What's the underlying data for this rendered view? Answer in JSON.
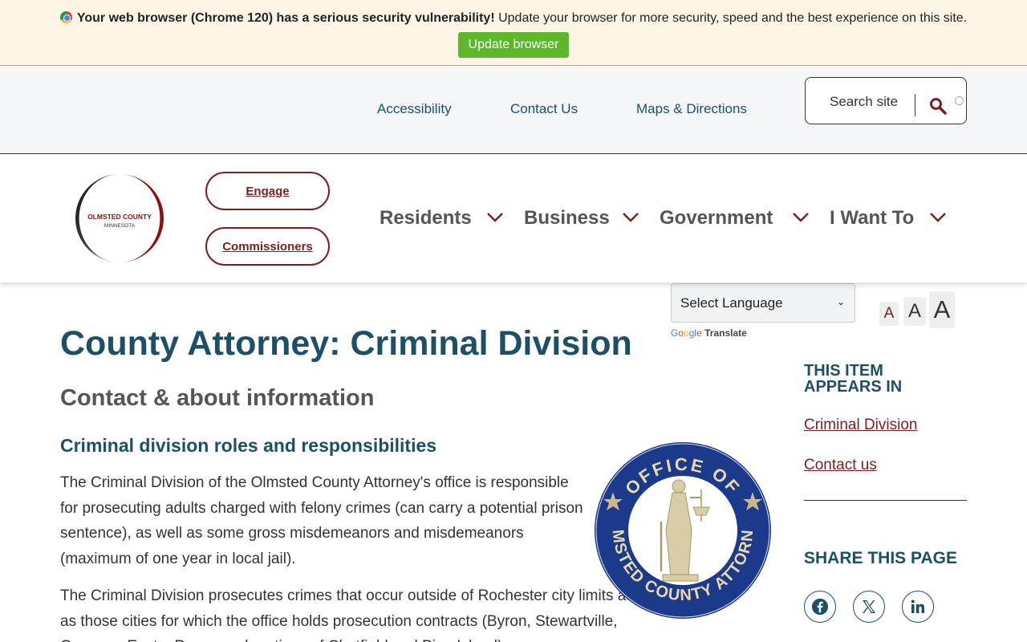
{
  "banner": {
    "bold_text": "Your web browser (Chrome 120) has a serious security vulnerability!",
    "text": " Update your browser for more security, speed and the best experience on this site.",
    "button_label": "Update browser"
  },
  "utility": {
    "links": [
      "Accessibility",
      "Contact Us",
      "Maps & Directions"
    ],
    "search_label": "Search site"
  },
  "logo": {
    "line1": "OLMSTED COUNTY",
    "line2": "MINNESOTA"
  },
  "header": {
    "pills": [
      "Engage",
      "Commissioners"
    ],
    "nav": [
      "Residents",
      "Business",
      "Government",
      "I Want To"
    ]
  },
  "language": {
    "select_label": "Select Language",
    "powered": "Translate"
  },
  "font_sizes": [
    "A",
    "A",
    "A"
  ],
  "content": {
    "title": "County Attorney: Criminal Division",
    "subtitle": "Contact & about information",
    "section_heading": "Criminal division roles and responsibilities",
    "para1": "The Criminal Division of the Olmsted County Attorney's office is responsible for prosecuting adults charged with felony crimes (can carry a potential prison sentence), as well as some gross misdemeanors and misdemeanors (maximum of one year in local jail).",
    "para2": "The Criminal Division prosecutes crimes that occur outside of Rochester city limits as well as those cities for which the office holds prosecution contracts (Byron, Stewartville, Oronoco, Eyota, Dover, and portions of Chatfield and Pine Island)."
  },
  "seal": {
    "top_text": "OFFICE OF",
    "bottom_text": "OLMSTED COUNTY ATTORNEY"
  },
  "sidebar": {
    "appears_in_line1": "THIS ITEM",
    "appears_in_line2": "APPEARS IN",
    "links": [
      "Criminal Division",
      "Contact us"
    ],
    "share_heading": "SHARE THIS PAGE",
    "share_icons": [
      "facebook-icon",
      "x-icon",
      "linkedin-icon"
    ]
  },
  "colors": {
    "accent_teal": "#1d4f66",
    "accent_maroon": "#7a1f1f",
    "update_green": "#5cb82a",
    "banner_bg": "#fdf5e6"
  }
}
